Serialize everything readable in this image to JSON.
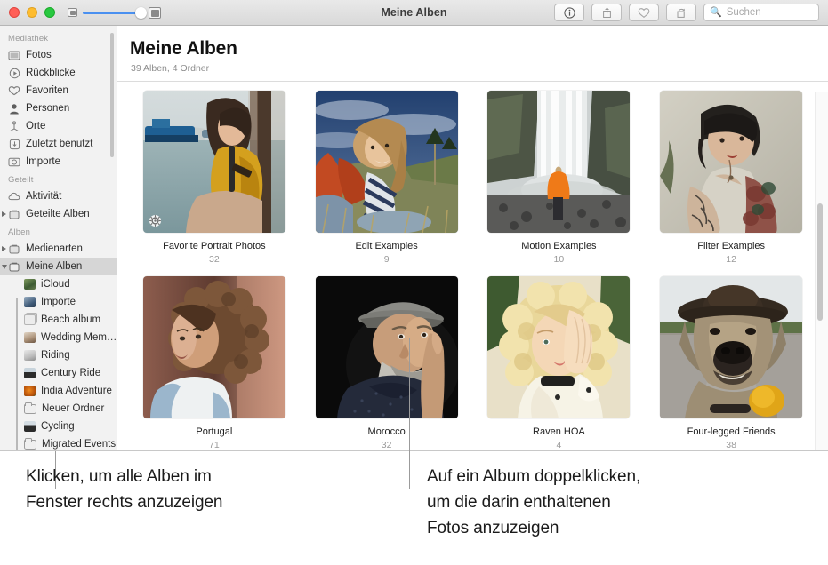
{
  "window": {
    "title": "Meine Alben",
    "traffic_lights": [
      "close",
      "minimize",
      "zoom"
    ],
    "zoom_slider": {
      "min_icon": "small-thumbnail-icon",
      "max_icon": "large-thumbnail-icon",
      "value_percent": 92
    },
    "toolbar_buttons": [
      {
        "name": "info-button",
        "icon": "info-circle-icon"
      },
      {
        "name": "share-button",
        "icon": "share-arrow-icon"
      },
      {
        "name": "favorite-button",
        "icon": "heart-icon"
      },
      {
        "name": "rotate-button",
        "icon": "rotate-icon"
      }
    ],
    "search": {
      "placeholder": "Suchen",
      "value": "",
      "icon": "search-icon"
    }
  },
  "sidebar": {
    "groups": [
      {
        "label": "Mediathek",
        "items": [
          {
            "label": "Fotos",
            "icon": "photos-icon",
            "selected": false,
            "disclosure": "none",
            "indent": 0
          },
          {
            "label": "Rückblicke",
            "icon": "memories-icon",
            "selected": false,
            "disclosure": "none",
            "indent": 0
          },
          {
            "label": "Favoriten",
            "icon": "heart-icon",
            "selected": false,
            "disclosure": "none",
            "indent": 0
          },
          {
            "label": "Personen",
            "icon": "person-icon",
            "selected": false,
            "disclosure": "none",
            "indent": 0
          },
          {
            "label": "Orte",
            "icon": "places-pin-icon",
            "selected": false,
            "disclosure": "none",
            "indent": 0
          },
          {
            "label": "Zuletzt benutzt",
            "icon": "recents-download-icon",
            "selected": false,
            "disclosure": "none",
            "indent": 0
          },
          {
            "label": "Importe",
            "icon": "camera-import-icon",
            "selected": false,
            "disclosure": "none",
            "indent": 0
          }
        ]
      },
      {
        "label": "Geteilt",
        "items": [
          {
            "label": "Aktivität",
            "icon": "cloud-icon",
            "selected": false,
            "disclosure": "none",
            "indent": 0
          },
          {
            "label": "Geteilte Alben",
            "icon": "album-stack-icon",
            "selected": false,
            "disclosure": "right",
            "indent": 0
          }
        ]
      },
      {
        "label": "Alben",
        "items": [
          {
            "label": "Medienarten",
            "icon": "album-stack-icon",
            "selected": false,
            "disclosure": "right",
            "indent": 0
          },
          {
            "label": "Meine Alben",
            "icon": "album-stack-icon",
            "selected": true,
            "disclosure": "down",
            "indent": 0
          },
          {
            "label": "iCloud",
            "icon": "album-thumb-icon",
            "selected": false,
            "disclosure": "none",
            "indent": 1,
            "color": "#5a7f4e"
          },
          {
            "label": "Importe",
            "icon": "album-thumb-icon",
            "selected": false,
            "disclosure": "none",
            "indent": 1,
            "color": "#4a6b8a"
          },
          {
            "label": "Beach album",
            "icon": "empty-album-icon",
            "selected": false,
            "disclosure": "none",
            "indent": 1,
            "color": "#e4e4e4"
          },
          {
            "label": "Wedding Mem…",
            "icon": "album-thumb-icon",
            "selected": false,
            "disclosure": "none",
            "indent": 1,
            "color": "#b9a290"
          },
          {
            "label": "Riding",
            "icon": "album-thumb-icon",
            "selected": false,
            "disclosure": "none",
            "indent": 1,
            "color": "#cfcfcf"
          },
          {
            "label": "Century Ride",
            "icon": "album-thumb-icon",
            "selected": false,
            "disclosure": "none",
            "indent": 1,
            "color": "#2b2b2b"
          },
          {
            "label": "India Adventure",
            "icon": "album-thumb-icon",
            "selected": false,
            "disclosure": "none",
            "indent": 1,
            "color": "#c96a12"
          },
          {
            "label": "Neuer Ordner",
            "icon": "folder-icon",
            "selected": false,
            "disclosure": "none",
            "indent": 1
          },
          {
            "label": "Cycling",
            "icon": "album-thumb-icon",
            "selected": false,
            "disclosure": "none",
            "indent": 1,
            "color": "#2b2b2b"
          },
          {
            "label": "Migrated Events",
            "icon": "folder-icon",
            "selected": false,
            "disclosure": "none",
            "indent": 1
          }
        ]
      }
    ]
  },
  "main": {
    "title": "Meine Alben",
    "subtitle": "39 Alben, 4 Ordner",
    "albums": [
      {
        "name": "Favorite Portrait Photos",
        "count": "32",
        "badge": "gear-icon",
        "thumb": {
          "type": "woman-at-harbor",
          "sky": "#c9d3d6",
          "water": "#8fa9ae",
          "accent": "#d99b1e",
          "dark": "#4b3b30"
        }
      },
      {
        "name": "Edit Examples",
        "count": "9",
        "badge": "",
        "thumb": {
          "type": "woman-on-hill",
          "sky": "#34518a",
          "water": "#7f8a5a",
          "accent": "#c44a25",
          "dark": "#2c3a52"
        }
      },
      {
        "name": "Motion Examples",
        "count": "10",
        "badge": "",
        "thumb": {
          "type": "waterfall",
          "sky": "#cfd2d1",
          "water": "#e6e8e7",
          "accent": "#e8741a",
          "dark": "#4a5246"
        }
      },
      {
        "name": "Filter Examples",
        "count": "12",
        "badge": "",
        "thumb": {
          "type": "tattooed-woman",
          "sky": "#cfccc0",
          "water": "#bfbcae",
          "accent": "#a34b3e",
          "dark": "#2a2522"
        }
      },
      {
        "name": "Portugal",
        "count": "71",
        "badge": "",
        "thumb": {
          "type": "curly-hair-woman",
          "sky": "#c29282",
          "water": "#6b4a3e",
          "accent": "#8c6248",
          "dark": "#3a2a22"
        }
      },
      {
        "name": "Morocco",
        "count": "32",
        "badge": "",
        "thumb": {
          "type": "old-man-dark",
          "sky": "#0a0a0a",
          "water": "#141414",
          "accent": "#7d7d78",
          "dark": "#050505"
        }
      },
      {
        "name": "Raven HOA",
        "count": "4",
        "badge": "",
        "thumb": {
          "type": "blonde-woman",
          "sky": "#e6dfc8",
          "water": "#f1ece0",
          "accent": "#e8c56a",
          "dark": "#3c5230"
        }
      },
      {
        "name": "Four-legged Friends",
        "count": "38",
        "badge": "",
        "thumb": {
          "type": "dog-with-hat",
          "sky": "#dfe4e6",
          "water": "#b8b4ab",
          "accent": "#3a2e22",
          "dark": "#5c5145"
        }
      }
    ]
  },
  "callouts": [
    {
      "name": "callout-sidebar",
      "text_lines": [
        "Klicken, um alle Alben im",
        "Fenster rechts anzuzeigen"
      ]
    },
    {
      "name": "callout-album",
      "text_lines": [
        "Auf ein Album doppelklicken,",
        "um die darin enthaltenen",
        "Fotos anzuzeigen"
      ]
    }
  ]
}
